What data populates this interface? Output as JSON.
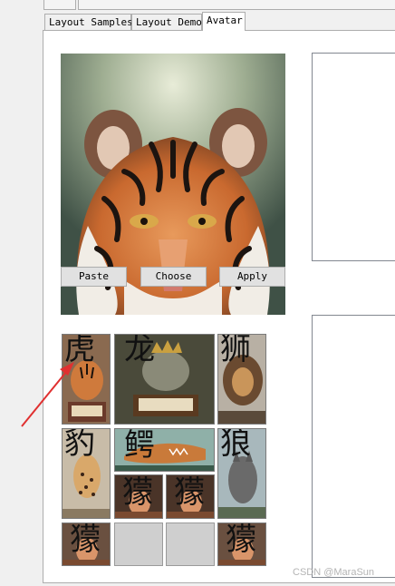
{
  "tabs": [
    {
      "label": "Layout Samples",
      "active": false
    },
    {
      "label": "Layout Demo",
      "active": false
    },
    {
      "label": "Avatar",
      "active": true
    }
  ],
  "avatar_buttons": {
    "paste": "Paste",
    "choose": "Choose",
    "apply": "Apply"
  },
  "grid": [
    {
      "label": "虎",
      "icon": "tiger-icon"
    },
    {
      "label": "龙",
      "icon": "dragon-icon"
    },
    {
      "label": "狮",
      "icon": "lion-icon"
    },
    {
      "label": "豹",
      "icon": "leopard-icon"
    },
    {
      "label": "鳄",
      "icon": "crocodile-icon"
    },
    {
      "label": "狼",
      "icon": "wolf-icon"
    },
    {
      "label": "獴",
      "icon": "mongoose-icon"
    },
    {
      "label": "獴",
      "icon": "mongoose-icon"
    },
    {
      "label": "獴",
      "icon": "mongoose-icon"
    },
    {
      "label": "",
      "icon": "empty-slot"
    },
    {
      "label": "",
      "icon": "empty-slot"
    },
    {
      "label": "獴",
      "icon": "mongoose-icon"
    }
  ],
  "watermark": "CSDN @MaraSun",
  "colors": {
    "arrow": "#e03030",
    "tab_border": "#adadad",
    "button_bg": "#e1e1e1"
  }
}
